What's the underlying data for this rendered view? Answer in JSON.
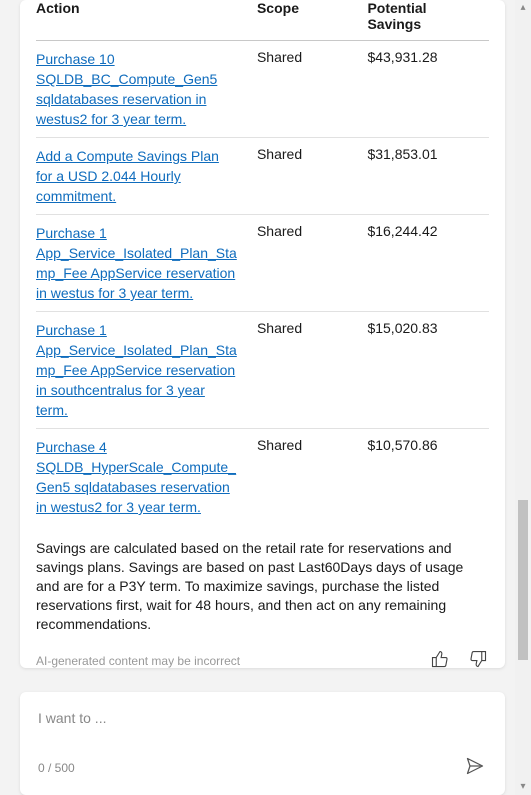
{
  "table": {
    "headers": {
      "action": "Action",
      "scope": "Scope",
      "savings": "Potential Savings"
    },
    "rows": [
      {
        "action": "Purchase 10 SQLDB_BC_Compute_Gen5 sqldatabases reservation in westus2 for 3 year term.",
        "scope": "Shared",
        "savings": "$43,931.28"
      },
      {
        "action": "Add a Compute Savings Plan for a USD 2.044 Hourly commitment.",
        "scope": "Shared",
        "savings": "$31,853.01"
      },
      {
        "action": "Purchase 1 App_Service_Isolated_Plan_Stamp_Fee AppService reservation in westus for 3 year term.",
        "scope": "Shared",
        "savings": "$16,244.42"
      },
      {
        "action": "Purchase 1 App_Service_Isolated_Plan_Stamp_Fee AppService reservation in southcentralus for 3 year term.",
        "scope": "Shared",
        "savings": "$15,020.83"
      },
      {
        "action": "Purchase 4 SQLDB_HyperScale_Compute_Gen5 sqldatabases reservation in westus2 for 3 year term.",
        "scope": "Shared",
        "savings": "$10,570.86"
      }
    ]
  },
  "footnote": "Savings are calculated based on the retail rate for reservations and savings plans. Savings are based on past Last60Days days of usage and are for a P3Y term. To maximize savings, purchase the listed reservations first, wait for 48 hours, and then act on any remaining recommendations.",
  "ai_disclaimer": "AI-generated content may be incorrect",
  "input": {
    "placeholder": "I want to ...",
    "char_count": "0 / 500"
  }
}
